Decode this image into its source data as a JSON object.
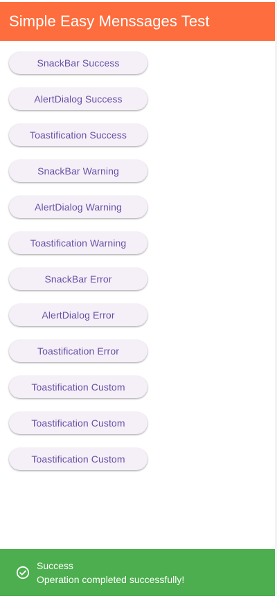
{
  "appbar": {
    "title": "Simple Easy Menssages Test"
  },
  "buttons": [
    {
      "label": "SnackBar Success"
    },
    {
      "label": "AlertDialog Success"
    },
    {
      "label": "Toastification Success"
    },
    {
      "label": "SnackBar Warning"
    },
    {
      "label": "AlertDialog Warning"
    },
    {
      "label": "Toastification Warning"
    },
    {
      "label": "SnackBar Error"
    },
    {
      "label": "AlertDialog Error"
    },
    {
      "label": "Toastification Error"
    },
    {
      "label": "Toastification Custom"
    },
    {
      "label": "Toastification Custom"
    },
    {
      "label": "Toastification Custom"
    }
  ],
  "snackbar": {
    "icon": "check-circle-icon",
    "title": "Success",
    "message": "Operation completed successfully!"
  },
  "colors": {
    "appbar": "#fe6d3d",
    "button_bg": "#f5eff8",
    "button_text": "#6750a4",
    "snackbar_bg": "#4cae4e"
  }
}
